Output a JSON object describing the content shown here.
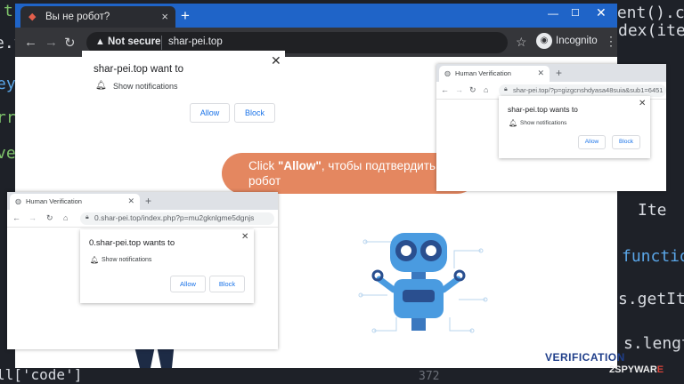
{
  "main_window": {
    "tab_title": "Вы не робот?",
    "nav": {
      "back": "←",
      "forward": "→",
      "reload": "↻"
    },
    "address": {
      "warning_icon": "warning-triangle-icon",
      "security_label": "Not secure",
      "url": "shar-pei.top"
    },
    "incognito_label": "Incognito",
    "notification_prompt": {
      "title": "shar-pei.top want to",
      "permission": "Show notifications",
      "allow_label": "Allow",
      "block_label": "Block"
    },
    "bubble": {
      "click": "Click ",
      "allow": "\"Allow\"",
      "rest": ", чтобы подтвердить, что вы не",
      "line2": "робот"
    },
    "brand_label": "VERIFICATION"
  },
  "overlay_top_right": {
    "tab_title": "Human Verification",
    "url": "shar-pei.top/?p=gizgcnshdyasa48suia&sub1=6451",
    "prompt_title": "shar-pei.top wants to",
    "permission": "Show notifications",
    "allow_label": "Allow",
    "block_label": "Block"
  },
  "overlay_bottom_left": {
    "tab_title": "Human Verification",
    "url": "0.shar-pei.top/index.php?p=mu2gknlgme5dgnjs",
    "prompt_title": "0.shar-pei.top wants to",
    "permission": "Show notifications",
    "allow_label": "Allow",
    "block_label": "Block"
  },
  "background_code": [
    "t-el",
    "rent().ch",
    "dex(item",
    "e.ta",
    "ey(",
    "rr",
    "ve",
    "Ite",
    "function",
    "s.getItemI",
    "s.length",
    "ll['code']",
    "372"
  ],
  "watermark": {
    "a": "2SPYWAR",
    "b": "E"
  },
  "colors": {
    "tabbar": "#1f64c8",
    "bubble": "#e48760",
    "robot": "#4a9be0",
    "allow_text": "#1a73e8"
  }
}
